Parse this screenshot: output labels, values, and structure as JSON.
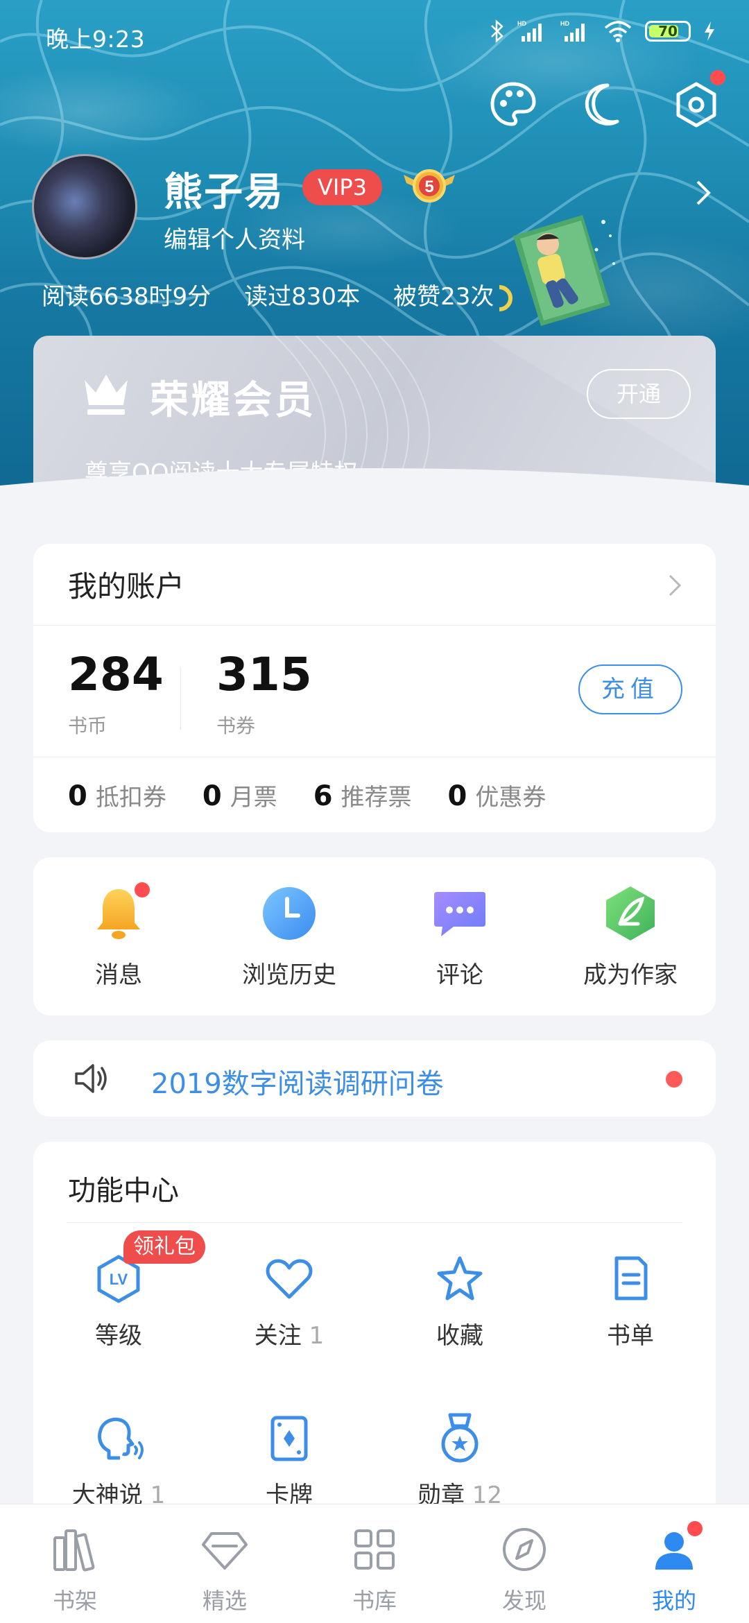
{
  "status_bar": {
    "time": "晚上9:23",
    "battery": "70"
  },
  "profile": {
    "name": "熊子易",
    "vip_badge": "VIP3",
    "medal_level": "5",
    "edit_label": "编辑个人资料",
    "stats": [
      "阅读6638时9分",
      "读过830本",
      "被赞23次"
    ]
  },
  "membership": {
    "title": "荣耀会员",
    "desc": "尊享QQ阅读十大专属特权",
    "button": "开通"
  },
  "account": {
    "title": "我的账户",
    "coins": {
      "value": "284",
      "label": "书币"
    },
    "vouchers": {
      "value": "315",
      "label": "书券"
    },
    "recharge": "充值",
    "tickets": [
      {
        "value": "0",
        "label": "抵扣券"
      },
      {
        "value": "0",
        "label": "月票"
      },
      {
        "value": "6",
        "label": "推荐票"
      },
      {
        "value": "0",
        "label": "优惠券"
      }
    ]
  },
  "shortcuts": [
    {
      "label": "消息"
    },
    {
      "label": "浏览历史"
    },
    {
      "label": "评论"
    },
    {
      "label": "成为作家"
    }
  ],
  "notice": {
    "text": "2019数字阅读调研问卷"
  },
  "function_center": {
    "title": "功能中心",
    "gift_badge": "领礼包",
    "items": [
      {
        "label": "等级",
        "count": ""
      },
      {
        "label": "关注",
        "count": "1"
      },
      {
        "label": "收藏",
        "count": ""
      },
      {
        "label": "书单",
        "count": ""
      },
      {
        "label": "大神说",
        "count": "1"
      },
      {
        "label": "卡牌",
        "count": ""
      },
      {
        "label": "勋章",
        "count": "12"
      }
    ]
  },
  "tabs": [
    {
      "label": "书架"
    },
    {
      "label": "精选"
    },
    {
      "label": "书库"
    },
    {
      "label": "发现"
    },
    {
      "label": "我的"
    }
  ],
  "colors": {
    "accent": "#2e8af0",
    "vip_red": "#ef4c4c",
    "notice_blue": "#3c8ee6"
  }
}
